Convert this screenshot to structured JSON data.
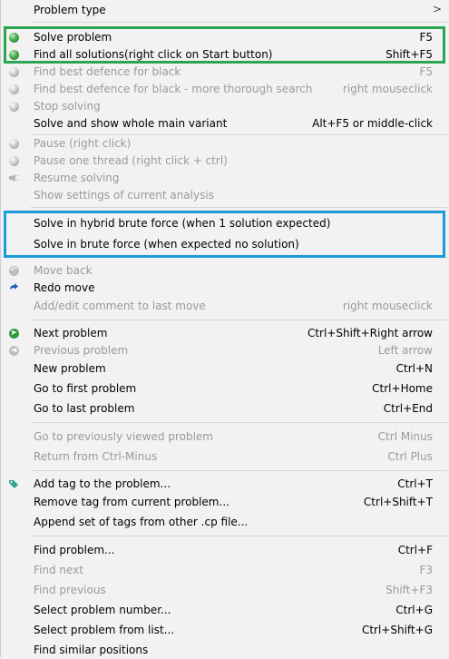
{
  "menu": {
    "problem_type": "Problem type",
    "submenu_arrow": ">",
    "solve_problem": {
      "label": "Solve problem",
      "shortcut": "F5"
    },
    "find_all_solutions": {
      "label": "Find all solutions(right click on Start button)",
      "shortcut": "Shift+F5"
    },
    "find_best_defence": {
      "label": "Find best defence for black",
      "shortcut": "F5"
    },
    "find_best_defence_thorough": {
      "label": "Find best defence for black - more thorough search",
      "shortcut": "right mouseclick"
    },
    "stop_solving": {
      "label": "Stop solving"
    },
    "solve_show_main_variant": {
      "label": "Solve and show whole main variant",
      "shortcut": "Alt+F5 or middle-click"
    },
    "pause": {
      "label": "Pause (right click)"
    },
    "pause_one_thread": {
      "label": "Pause one thread (right click + ctrl)"
    },
    "resume_solving": {
      "label": "Resume solving"
    },
    "show_settings_analysis": {
      "label": "Show settings of current analysis"
    },
    "solve_hybrid_brute": {
      "label": "Solve in hybrid brute force (when 1 solution expected)"
    },
    "solve_brute": {
      "label": "Solve in brute force (when expected no solution)"
    },
    "move_back": {
      "label": "Move back"
    },
    "redo_move": {
      "label": "Redo move"
    },
    "add_edit_comment": {
      "label": "Add/edit comment to last move",
      "shortcut": "right mouseclick"
    },
    "next_problem": {
      "label": "Next problem",
      "shortcut": "Ctrl+Shift+Right arrow"
    },
    "previous_problem": {
      "label": "Previous problem",
      "shortcut": "Left arrow"
    },
    "new_problem": {
      "label": "New problem",
      "shortcut": "Ctrl+N"
    },
    "go_first_problem": {
      "label": "Go to first problem",
      "shortcut": "Ctrl+Home"
    },
    "go_last_problem": {
      "label": "Go to last problem",
      "shortcut": "Ctrl+End"
    },
    "go_previously_viewed": {
      "label": "Go to previously viewed problem",
      "shortcut": "Ctrl Minus"
    },
    "return_from_ctrl_minus": {
      "label": "Return from Ctrl-Minus",
      "shortcut": "Ctrl Plus"
    },
    "add_tag": {
      "label": "Add tag to the problem...",
      "shortcut": "Ctrl+T"
    },
    "remove_tag": {
      "label": "Remove tag from current problem...",
      "shortcut": "Ctrl+Shift+T"
    },
    "append_tags": {
      "label": "Append set of tags from other .cp file..."
    },
    "find_problem": {
      "label": "Find problem...",
      "shortcut": "Ctrl+F"
    },
    "find_next": {
      "label": "Find next",
      "shortcut": "F3"
    },
    "find_previous": {
      "label": "Find previous",
      "shortcut": "Shift+F3"
    },
    "select_problem_number": {
      "label": "Select problem number...",
      "shortcut": "Ctrl+G"
    },
    "select_problem_list": {
      "label": "Select problem from list...",
      "shortcut": "Ctrl+Shift+G"
    },
    "find_similar_positions": {
      "label": "Find similar positions"
    }
  },
  "colors": {
    "highlight_green": "#2aa652",
    "highlight_blue": "#1a9cd8",
    "disabled_text": "#9a9a9a",
    "menu_background": "#f2f2f2"
  },
  "icons": {
    "solve": "green-ball-icon",
    "stop": "gray-ball-icon",
    "redo": "redo-arrow-icon",
    "next": "green-arrow-icon",
    "previous": "gray-arrow-icon",
    "tag": "tag-icon"
  }
}
